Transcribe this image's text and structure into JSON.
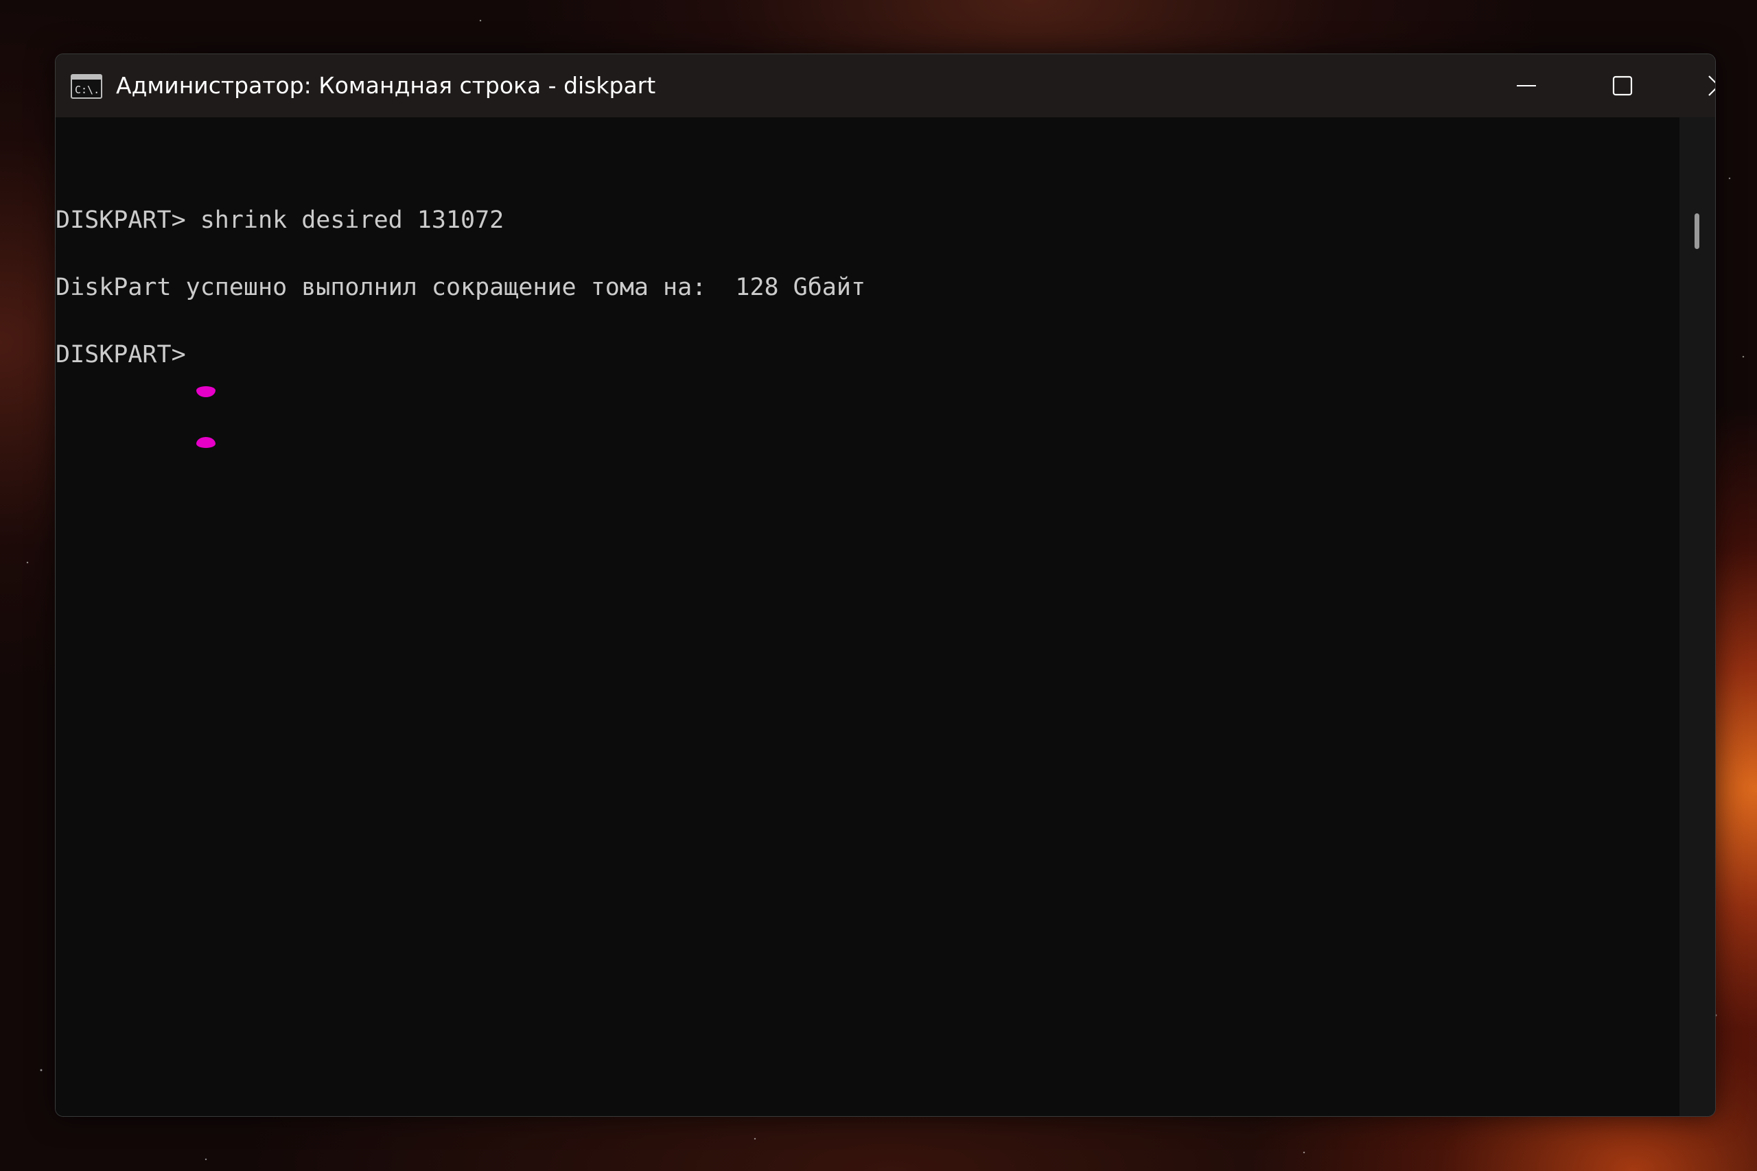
{
  "window": {
    "title": "Администратор: Командная строка - diskpart",
    "app_icon": "cmd-icon",
    "app_icon_text": "C:\\.",
    "controls": {
      "minimize": "minimize-icon",
      "maximize": "maximize-icon",
      "close": "close-icon"
    }
  },
  "console": {
    "lines": [
      "DISKPART> shrink desired 131072",
      "DiskPart успешно выполнил сокращение тома на:  128 Gбайт",
      "DISKPART> "
    ],
    "text_color": "#cccccc",
    "background_color": "#0c0c0c",
    "cursor_color": "#e600c8"
  },
  "scrollbar": {
    "position_fraction": 0
  }
}
